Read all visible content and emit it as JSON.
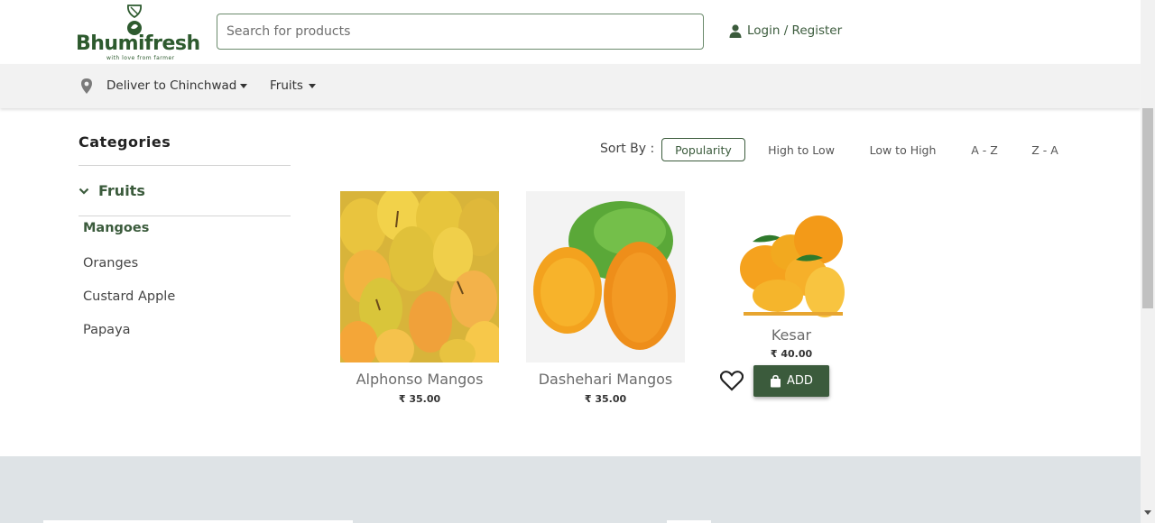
{
  "brand": {
    "name": "Bhumifresh",
    "tagline": "with love from farmer",
    "color": "#2d5a2e"
  },
  "header": {
    "search_placeholder": "Search for products",
    "login_label": "Login / Register"
  },
  "subnav": {
    "deliver_label": "Deliver to Chinchwad",
    "fruits_label": "Fruits"
  },
  "sidebar": {
    "title": "Categories",
    "parent": "Fruits",
    "items": [
      {
        "label": "Mangoes",
        "active": true
      },
      {
        "label": "Oranges",
        "active": false
      },
      {
        "label": "Custard Apple",
        "active": false
      },
      {
        "label": "Papaya",
        "active": false
      }
    ]
  },
  "sort": {
    "label": "Sort By :",
    "options": [
      "Popularity",
      "High to Low",
      "Low to High",
      "A - Z",
      "Z - A"
    ],
    "selected": "Popularity"
  },
  "products": [
    {
      "name": "Alphonso Mangos",
      "price": "₹ 35.00"
    },
    {
      "name": "Dashehari Mangos",
      "price": "₹ 35.00"
    },
    {
      "name": "Kesar",
      "price": "₹ 40.00"
    }
  ],
  "actions": {
    "add_label": "ADD"
  },
  "colors": {
    "accent": "#3b5b3c",
    "subnav_bg": "#f2f2f2",
    "footer_bg": "#dee3e6"
  }
}
